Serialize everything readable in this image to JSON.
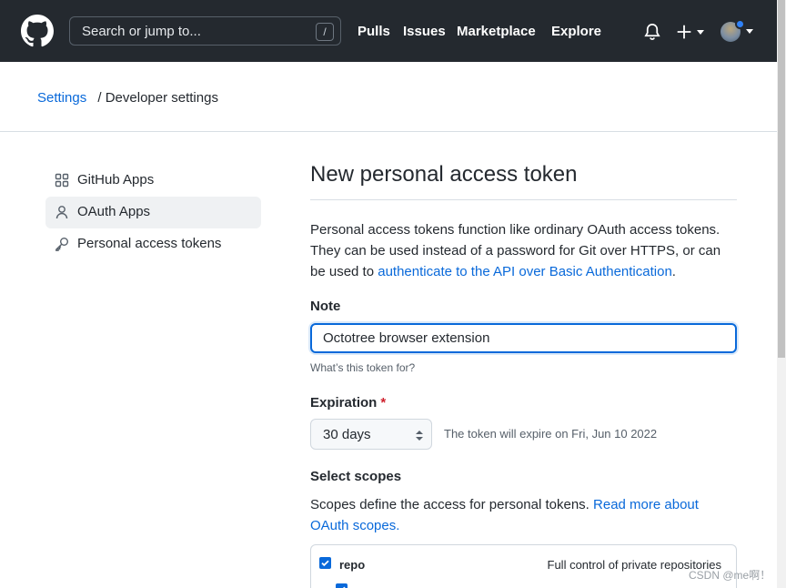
{
  "header": {
    "search_placeholder": "Search or jump to...",
    "search_shortcut": "/",
    "nav": [
      "Pulls",
      "Issues",
      "Marketplace",
      "Explore"
    ]
  },
  "breadcrumb": {
    "settings": "Settings",
    "separator": "/",
    "current": "Developer settings"
  },
  "sidebar": {
    "items": [
      {
        "label": "GitHub Apps",
        "icon": "apps-grid-icon",
        "active": false
      },
      {
        "label": "OAuth Apps",
        "icon": "person-icon",
        "active": true
      },
      {
        "label": "Personal access tokens",
        "icon": "key-icon",
        "active": false
      }
    ]
  },
  "main": {
    "title": "New personal access token",
    "intro_text": "Personal access tokens function like ordinary OAuth access tokens. They can be used instead of a password for Git over HTTPS, or can be used to ",
    "intro_link": "authenticate to the API over Basic Authentication",
    "intro_end": ".",
    "note_label": "Note",
    "note_value": "Octotree browser extension",
    "note_hint": "What’s this token for?",
    "expiration_label": "Expiration",
    "expiration_required": "*",
    "expiration_value": "30 days",
    "expiration_note": "The token will expire on Fri, Jun 10 2022",
    "scopes_label": "Select scopes",
    "scopes_text": "Scopes define the access for personal tokens. ",
    "scopes_link": "Read more about OAuth scopes.",
    "scopes": [
      {
        "name": "repo",
        "description": "Full control of private repositories",
        "checked": true
      }
    ]
  },
  "watermark": "CSDN @me啊！",
  "colors": {
    "header_bg": "#24292f",
    "link": "#0969da",
    "focus_border": "#0969da",
    "required": "#cf222e",
    "notification_dot": "#2f81f7"
  }
}
